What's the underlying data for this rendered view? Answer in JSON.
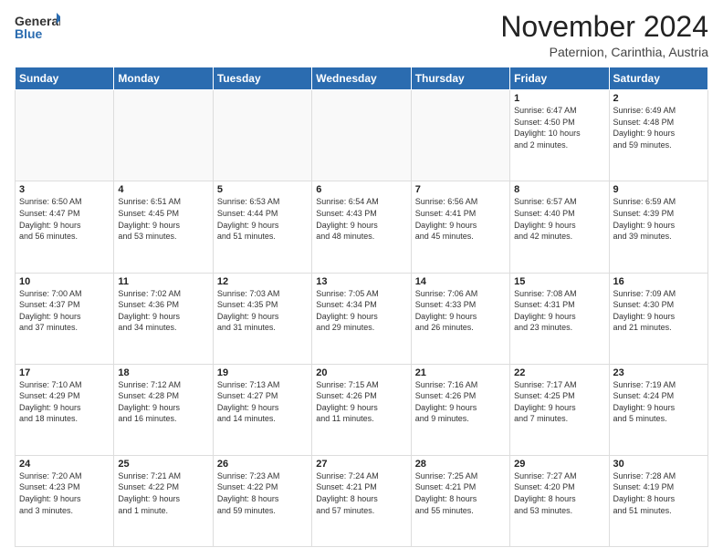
{
  "logo": {
    "line1": "General",
    "line2": "Blue"
  },
  "title": "November 2024",
  "location": "Paternion, Carinthia, Austria",
  "days_header": [
    "Sunday",
    "Monday",
    "Tuesday",
    "Wednesday",
    "Thursday",
    "Friday",
    "Saturday"
  ],
  "weeks": [
    [
      {
        "day": "",
        "info": ""
      },
      {
        "day": "",
        "info": ""
      },
      {
        "day": "",
        "info": ""
      },
      {
        "day": "",
        "info": ""
      },
      {
        "day": "",
        "info": ""
      },
      {
        "day": "1",
        "info": "Sunrise: 6:47 AM\nSunset: 4:50 PM\nDaylight: 10 hours\nand 2 minutes."
      },
      {
        "day": "2",
        "info": "Sunrise: 6:49 AM\nSunset: 4:48 PM\nDaylight: 9 hours\nand 59 minutes."
      }
    ],
    [
      {
        "day": "3",
        "info": "Sunrise: 6:50 AM\nSunset: 4:47 PM\nDaylight: 9 hours\nand 56 minutes."
      },
      {
        "day": "4",
        "info": "Sunrise: 6:51 AM\nSunset: 4:45 PM\nDaylight: 9 hours\nand 53 minutes."
      },
      {
        "day": "5",
        "info": "Sunrise: 6:53 AM\nSunset: 4:44 PM\nDaylight: 9 hours\nand 51 minutes."
      },
      {
        "day": "6",
        "info": "Sunrise: 6:54 AM\nSunset: 4:43 PM\nDaylight: 9 hours\nand 48 minutes."
      },
      {
        "day": "7",
        "info": "Sunrise: 6:56 AM\nSunset: 4:41 PM\nDaylight: 9 hours\nand 45 minutes."
      },
      {
        "day": "8",
        "info": "Sunrise: 6:57 AM\nSunset: 4:40 PM\nDaylight: 9 hours\nand 42 minutes."
      },
      {
        "day": "9",
        "info": "Sunrise: 6:59 AM\nSunset: 4:39 PM\nDaylight: 9 hours\nand 39 minutes."
      }
    ],
    [
      {
        "day": "10",
        "info": "Sunrise: 7:00 AM\nSunset: 4:37 PM\nDaylight: 9 hours\nand 37 minutes."
      },
      {
        "day": "11",
        "info": "Sunrise: 7:02 AM\nSunset: 4:36 PM\nDaylight: 9 hours\nand 34 minutes."
      },
      {
        "day": "12",
        "info": "Sunrise: 7:03 AM\nSunset: 4:35 PM\nDaylight: 9 hours\nand 31 minutes."
      },
      {
        "day": "13",
        "info": "Sunrise: 7:05 AM\nSunset: 4:34 PM\nDaylight: 9 hours\nand 29 minutes."
      },
      {
        "day": "14",
        "info": "Sunrise: 7:06 AM\nSunset: 4:33 PM\nDaylight: 9 hours\nand 26 minutes."
      },
      {
        "day": "15",
        "info": "Sunrise: 7:08 AM\nSunset: 4:31 PM\nDaylight: 9 hours\nand 23 minutes."
      },
      {
        "day": "16",
        "info": "Sunrise: 7:09 AM\nSunset: 4:30 PM\nDaylight: 9 hours\nand 21 minutes."
      }
    ],
    [
      {
        "day": "17",
        "info": "Sunrise: 7:10 AM\nSunset: 4:29 PM\nDaylight: 9 hours\nand 18 minutes."
      },
      {
        "day": "18",
        "info": "Sunrise: 7:12 AM\nSunset: 4:28 PM\nDaylight: 9 hours\nand 16 minutes."
      },
      {
        "day": "19",
        "info": "Sunrise: 7:13 AM\nSunset: 4:27 PM\nDaylight: 9 hours\nand 14 minutes."
      },
      {
        "day": "20",
        "info": "Sunrise: 7:15 AM\nSunset: 4:26 PM\nDaylight: 9 hours\nand 11 minutes."
      },
      {
        "day": "21",
        "info": "Sunrise: 7:16 AM\nSunset: 4:26 PM\nDaylight: 9 hours\nand 9 minutes."
      },
      {
        "day": "22",
        "info": "Sunrise: 7:17 AM\nSunset: 4:25 PM\nDaylight: 9 hours\nand 7 minutes."
      },
      {
        "day": "23",
        "info": "Sunrise: 7:19 AM\nSunset: 4:24 PM\nDaylight: 9 hours\nand 5 minutes."
      }
    ],
    [
      {
        "day": "24",
        "info": "Sunrise: 7:20 AM\nSunset: 4:23 PM\nDaylight: 9 hours\nand 3 minutes."
      },
      {
        "day": "25",
        "info": "Sunrise: 7:21 AM\nSunset: 4:22 PM\nDaylight: 9 hours\nand 1 minute."
      },
      {
        "day": "26",
        "info": "Sunrise: 7:23 AM\nSunset: 4:22 PM\nDaylight: 8 hours\nand 59 minutes."
      },
      {
        "day": "27",
        "info": "Sunrise: 7:24 AM\nSunset: 4:21 PM\nDaylight: 8 hours\nand 57 minutes."
      },
      {
        "day": "28",
        "info": "Sunrise: 7:25 AM\nSunset: 4:21 PM\nDaylight: 8 hours\nand 55 minutes."
      },
      {
        "day": "29",
        "info": "Sunrise: 7:27 AM\nSunset: 4:20 PM\nDaylight: 8 hours\nand 53 minutes."
      },
      {
        "day": "30",
        "info": "Sunrise: 7:28 AM\nSunset: 4:19 PM\nDaylight: 8 hours\nand 51 minutes."
      }
    ]
  ]
}
